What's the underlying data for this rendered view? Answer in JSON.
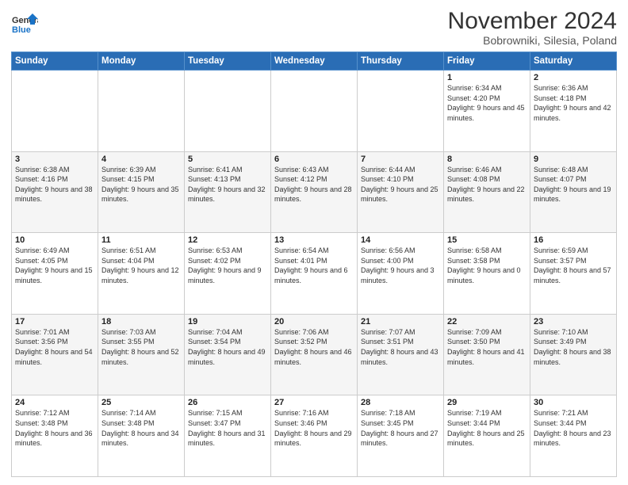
{
  "logo": {
    "line1": "General",
    "line2": "Blue"
  },
  "title": "November 2024",
  "subtitle": "Bobrowniki, Silesia, Poland",
  "days_header": [
    "Sunday",
    "Monday",
    "Tuesday",
    "Wednesday",
    "Thursday",
    "Friday",
    "Saturday"
  ],
  "weeks": [
    [
      {
        "day": "",
        "info": ""
      },
      {
        "day": "",
        "info": ""
      },
      {
        "day": "",
        "info": ""
      },
      {
        "day": "",
        "info": ""
      },
      {
        "day": "",
        "info": ""
      },
      {
        "day": "1",
        "info": "Sunrise: 6:34 AM\nSunset: 4:20 PM\nDaylight: 9 hours and 45 minutes."
      },
      {
        "day": "2",
        "info": "Sunrise: 6:36 AM\nSunset: 4:18 PM\nDaylight: 9 hours and 42 minutes."
      }
    ],
    [
      {
        "day": "3",
        "info": "Sunrise: 6:38 AM\nSunset: 4:16 PM\nDaylight: 9 hours and 38 minutes."
      },
      {
        "day": "4",
        "info": "Sunrise: 6:39 AM\nSunset: 4:15 PM\nDaylight: 9 hours and 35 minutes."
      },
      {
        "day": "5",
        "info": "Sunrise: 6:41 AM\nSunset: 4:13 PM\nDaylight: 9 hours and 32 minutes."
      },
      {
        "day": "6",
        "info": "Sunrise: 6:43 AM\nSunset: 4:12 PM\nDaylight: 9 hours and 28 minutes."
      },
      {
        "day": "7",
        "info": "Sunrise: 6:44 AM\nSunset: 4:10 PM\nDaylight: 9 hours and 25 minutes."
      },
      {
        "day": "8",
        "info": "Sunrise: 6:46 AM\nSunset: 4:08 PM\nDaylight: 9 hours and 22 minutes."
      },
      {
        "day": "9",
        "info": "Sunrise: 6:48 AM\nSunset: 4:07 PM\nDaylight: 9 hours and 19 minutes."
      }
    ],
    [
      {
        "day": "10",
        "info": "Sunrise: 6:49 AM\nSunset: 4:05 PM\nDaylight: 9 hours and 15 minutes."
      },
      {
        "day": "11",
        "info": "Sunrise: 6:51 AM\nSunset: 4:04 PM\nDaylight: 9 hours and 12 minutes."
      },
      {
        "day": "12",
        "info": "Sunrise: 6:53 AM\nSunset: 4:02 PM\nDaylight: 9 hours and 9 minutes."
      },
      {
        "day": "13",
        "info": "Sunrise: 6:54 AM\nSunset: 4:01 PM\nDaylight: 9 hours and 6 minutes."
      },
      {
        "day": "14",
        "info": "Sunrise: 6:56 AM\nSunset: 4:00 PM\nDaylight: 9 hours and 3 minutes."
      },
      {
        "day": "15",
        "info": "Sunrise: 6:58 AM\nSunset: 3:58 PM\nDaylight: 9 hours and 0 minutes."
      },
      {
        "day": "16",
        "info": "Sunrise: 6:59 AM\nSunset: 3:57 PM\nDaylight: 8 hours and 57 minutes."
      }
    ],
    [
      {
        "day": "17",
        "info": "Sunrise: 7:01 AM\nSunset: 3:56 PM\nDaylight: 8 hours and 54 minutes."
      },
      {
        "day": "18",
        "info": "Sunrise: 7:03 AM\nSunset: 3:55 PM\nDaylight: 8 hours and 52 minutes."
      },
      {
        "day": "19",
        "info": "Sunrise: 7:04 AM\nSunset: 3:54 PM\nDaylight: 8 hours and 49 minutes."
      },
      {
        "day": "20",
        "info": "Sunrise: 7:06 AM\nSunset: 3:52 PM\nDaylight: 8 hours and 46 minutes."
      },
      {
        "day": "21",
        "info": "Sunrise: 7:07 AM\nSunset: 3:51 PM\nDaylight: 8 hours and 43 minutes."
      },
      {
        "day": "22",
        "info": "Sunrise: 7:09 AM\nSunset: 3:50 PM\nDaylight: 8 hours and 41 minutes."
      },
      {
        "day": "23",
        "info": "Sunrise: 7:10 AM\nSunset: 3:49 PM\nDaylight: 8 hours and 38 minutes."
      }
    ],
    [
      {
        "day": "24",
        "info": "Sunrise: 7:12 AM\nSunset: 3:48 PM\nDaylight: 8 hours and 36 minutes."
      },
      {
        "day": "25",
        "info": "Sunrise: 7:14 AM\nSunset: 3:48 PM\nDaylight: 8 hours and 34 minutes."
      },
      {
        "day": "26",
        "info": "Sunrise: 7:15 AM\nSunset: 3:47 PM\nDaylight: 8 hours and 31 minutes."
      },
      {
        "day": "27",
        "info": "Sunrise: 7:16 AM\nSunset: 3:46 PM\nDaylight: 8 hours and 29 minutes."
      },
      {
        "day": "28",
        "info": "Sunrise: 7:18 AM\nSunset: 3:45 PM\nDaylight: 8 hours and 27 minutes."
      },
      {
        "day": "29",
        "info": "Sunrise: 7:19 AM\nSunset: 3:44 PM\nDaylight: 8 hours and 25 minutes."
      },
      {
        "day": "30",
        "info": "Sunrise: 7:21 AM\nSunset: 3:44 PM\nDaylight: 8 hours and 23 minutes."
      }
    ]
  ]
}
